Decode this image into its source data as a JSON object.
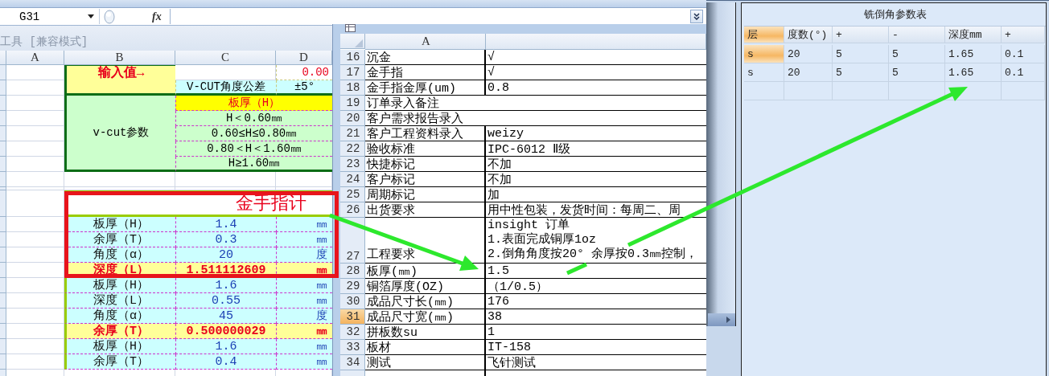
{
  "formula_bar": {
    "name_box": "G31",
    "function_label": "fx"
  },
  "left_sheet": {
    "title": "工具 [兼容模式]",
    "columns": [
      "A",
      "B",
      "C",
      "D"
    ],
    "input_block": {
      "label": "输入值→",
      "value": "0.00",
      "tolerance_label": "V-CUT角度公差",
      "tolerance": "±5°"
    },
    "vcut_block": {
      "label": "v-cut参数",
      "header": "板厚（H）",
      "ranges": [
        "H＜0.60㎜",
        "0.60≤H≤0.80㎜",
        "0.80＜H＜1.60㎜",
        "H≥1.60㎜"
      ]
    },
    "gold_finger_block": {
      "title": "金手指计",
      "rows": [
        {
          "kind": "input",
          "label": "板厚（H）",
          "value": "1.4",
          "unit": "㎜"
        },
        {
          "kind": "input",
          "label": "余厚（T）",
          "value": "0.3",
          "unit": "㎜"
        },
        {
          "kind": "input",
          "label": "角度（α）",
          "value": "20",
          "unit": "度"
        },
        {
          "kind": "result",
          "label": "深度（L）",
          "value": "1.511112609",
          "unit": "㎜"
        },
        {
          "kind": "input",
          "label": "板厚（H）",
          "value": "1.6",
          "unit": "㎜"
        },
        {
          "kind": "input",
          "label": "深度（L）",
          "value": "0.55",
          "unit": "㎜"
        },
        {
          "kind": "input",
          "label": "角度（α）",
          "value": "45",
          "unit": "度"
        },
        {
          "kind": "result",
          "label": "余厚（T）",
          "value": "0.500000029",
          "unit": "㎜"
        },
        {
          "kind": "input",
          "label": "板厚（H）",
          "value": "1.6",
          "unit": "㎜"
        },
        {
          "kind": "input",
          "label": "余厚（T）",
          "value": "0.4",
          "unit": "㎜"
        }
      ]
    }
  },
  "order_sheet": {
    "column": "A",
    "rows": [
      {
        "number": "16",
        "label": "沉金",
        "value": "√",
        "selected": false
      },
      {
        "number": "17",
        "label": "金手指",
        "value": "√",
        "selected": false
      },
      {
        "number": "18",
        "label": "金手指金厚(um)",
        "value": "0.8",
        "selected": false
      },
      {
        "number": "19",
        "label": "订单录入备注",
        "selected": false
      },
      {
        "number": "20",
        "label": "客户需求报告录入",
        "selected": false
      },
      {
        "number": "21",
        "label": "客户工程资料录入",
        "value": "weizy",
        "selected": false
      },
      {
        "number": "22",
        "label": "验收标准",
        "value": "IPC-6012 Ⅱ级",
        "selected": false
      },
      {
        "number": "23",
        "label": "快捷标记",
        "value": "不加",
        "selected": false
      },
      {
        "number": "24",
        "label": "客户标记",
        "value": "不加",
        "selected": false
      },
      {
        "number": "25",
        "label": "周期标记",
        "value": "加",
        "selected": false
      },
      {
        "number": "26",
        "label": "出货要求",
        "value": "用中性包装，发货时间：每周二、周",
        "selected": false
      },
      {
        "number": "27",
        "label": "工程要求",
        "value_lines": [
          "insight 订单",
          "1.表面完成铜厚1oz",
          "2.倒角角度按20°  余厚按0.3㎜控制，"
        ],
        "selected": false
      },
      {
        "number": "28",
        "label": "板厚(㎜)",
        "value": "1.5",
        "selected": false
      },
      {
        "number": "29",
        "label": "铜箔厚度(OZ)",
        "value": "（1/0.5）",
        "selected": false
      },
      {
        "number": "30",
        "label": "成品尺寸长(㎜)",
        "value": "176",
        "selected": false
      },
      {
        "number": "31",
        "label": "成品尺寸宽(㎜)",
        "value": "38",
        "selected": true
      },
      {
        "number": "32",
        "label": "拼板数su",
        "value": "1",
        "selected": false
      },
      {
        "number": "33",
        "label": "板材",
        "value": "IT-158",
        "selected": false
      },
      {
        "number": "34",
        "label": "测试",
        "value": "飞针测试",
        "selected": false
      }
    ]
  },
  "chamfer_table": {
    "title": "铣倒角参数表",
    "columns": [
      "层",
      "度数(°)",
      "+",
      "-",
      "深度mm",
      "+"
    ],
    "rows": [
      {
        "selected": true,
        "cells": [
          "s",
          "20",
          "5",
          "5",
          "1.65",
          "0.1"
        ]
      },
      {
        "selected": false,
        "cells": [
          "s",
          "20",
          "5",
          "5",
          "1.65",
          "0.1"
        ]
      }
    ]
  }
}
